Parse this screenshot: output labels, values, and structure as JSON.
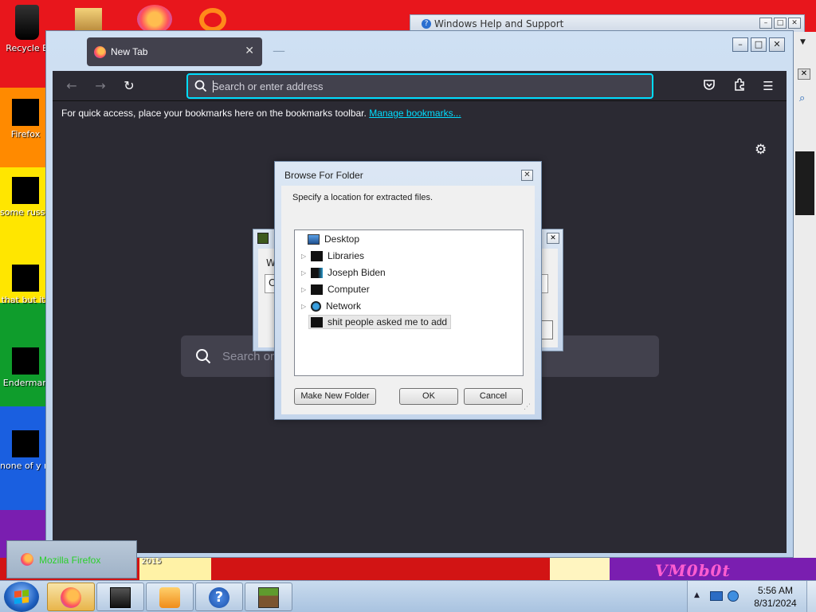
{
  "colors": {
    "accent_focus": "#00ddff",
    "ff_toolbar": "#2b2a33",
    "ff_field": "#42414d",
    "link": "#00ddff",
    "taskbar_popup_text": "#2bd02b"
  },
  "desktop": {
    "icons": [
      {
        "label": "Recycle B",
        "icon": "recycle-bin-icon"
      },
      {
        "label": "Firefox",
        "icon": "firefox-icon"
      },
      {
        "label": "some russ ran a ra",
        "icon": "file-icon"
      },
      {
        "label": "that but its",
        "icon": "file-icon"
      },
      {
        "label": "Enderman",
        "icon": "file-icon"
      },
      {
        "label": "none of y retards kn",
        "icon": "file-icon"
      },
      {
        "label": "2015",
        "icon": "file-icon"
      }
    ],
    "wallpaper_text": "VM0b0t",
    "help_window_title": "Windows Help and Support"
  },
  "browser": {
    "tab_title": "New Tab",
    "url_placeholder": "Search or enter address",
    "bookmarks_message": "For quick access, place your bookmarks here on the bookmarks toolbar.",
    "bookmarks_link": "Manage bookmarks...",
    "home_search_placeholder": "Search or"
  },
  "extract_dialog": {
    "label_fragment": "W",
    "path_fragment": "C:"
  },
  "browse_dialog": {
    "title": "Browse For Folder",
    "message": "Specify a location for extracted files.",
    "tree": [
      {
        "label": "Desktop",
        "icon": "desktop-icon",
        "expandable": false,
        "selected": false
      },
      {
        "label": "Libraries",
        "icon": "libraries-icon",
        "expandable": true,
        "selected": false
      },
      {
        "label": "Joseph Biden",
        "icon": "user-folder-icon",
        "expandable": true,
        "selected": false
      },
      {
        "label": "Computer",
        "icon": "computer-icon",
        "expandable": true,
        "selected": false
      },
      {
        "label": "Network",
        "icon": "network-icon",
        "expandable": true,
        "selected": false
      },
      {
        "label": "shit people asked me to add",
        "icon": "folder-icon",
        "expandable": false,
        "selected": true
      }
    ],
    "buttons": {
      "new_folder": "Make New Folder",
      "ok": "OK",
      "cancel": "Cancel"
    }
  },
  "taskbar": {
    "popup_label": "Mozilla Firefox",
    "apps": [
      "firefox-icon",
      "terminal-icon",
      "media-player-icon",
      "help-icon",
      "minecraft-icon"
    ],
    "time": "5:56 AM",
    "date": "8/31/2024"
  }
}
